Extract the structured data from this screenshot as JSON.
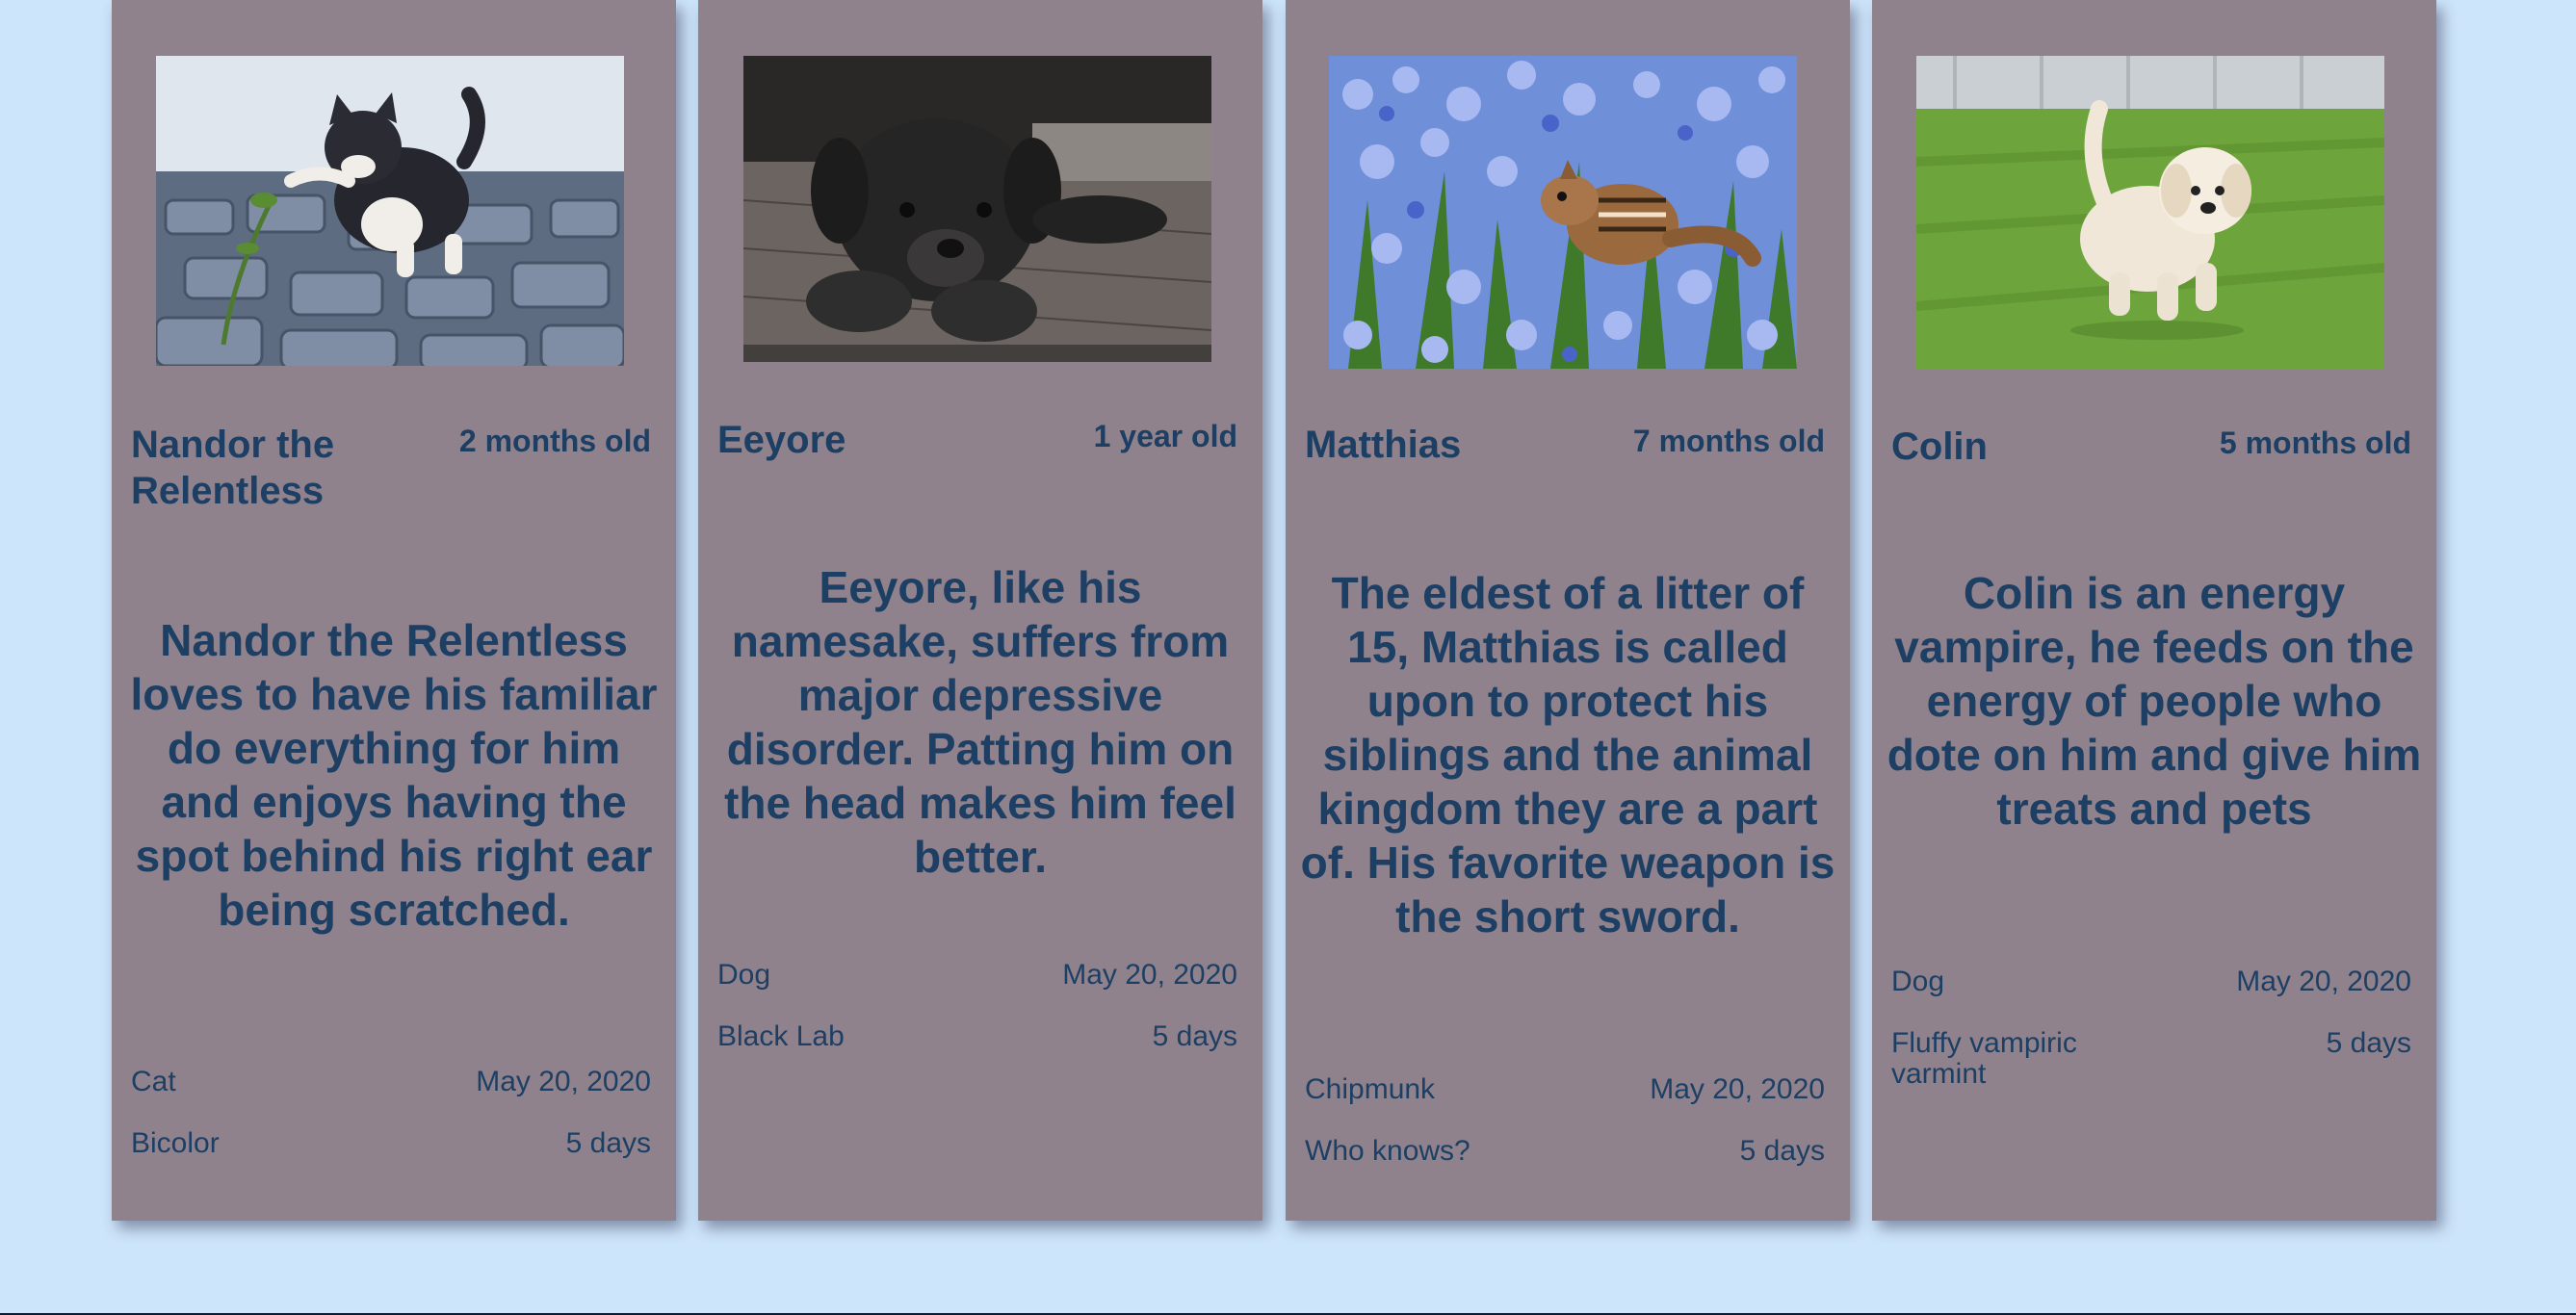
{
  "pets": [
    {
      "name": "Nandor the Relentless",
      "age": "2 months old",
      "description": "Nandor the Relentless loves to have his familiar do everything for him and enjoys having the spot behind his right ear being scratched.",
      "species": "Cat",
      "date": "May 20, 2020",
      "breed": "Bicolor",
      "duration": "5 days",
      "photo": "kitten-photo"
    },
    {
      "name": "Eeyore",
      "age": "1 year old",
      "description": "Eeyore, like his namesake, suffers from major depressive disorder. Patting him on the head makes him feel better.",
      "species": "Dog",
      "date": "May 20, 2020",
      "breed": "Black Lab",
      "duration": "5 days",
      "photo": "black-puppy-photo"
    },
    {
      "name": "Matthias",
      "age": "7 months old",
      "description": "The eldest of a litter of 15, Matthias is called upon to protect his siblings and the animal kingdom they are a part of. His favorite weapon is the short sword.",
      "species": "Chipmunk",
      "date": "May 20, 2020",
      "breed": "Who knows?",
      "duration": "5 days",
      "photo": "chipmunk-in-flowers-photo"
    },
    {
      "name": "Colin",
      "age": "5 months old",
      "description": "Colin is an energy vampire, he feeds on the energy of people who dote on him and give him treats and pets",
      "species": "Dog",
      "date": "May 20, 2020",
      "breed": "Fluffy vampiric varmint",
      "duration": "5 days",
      "photo": "white-puppy-on-grass-photo"
    }
  ],
  "colors": {
    "background": "#cde5fb",
    "card": "#8f828d",
    "text": "#1d3f63"
  }
}
